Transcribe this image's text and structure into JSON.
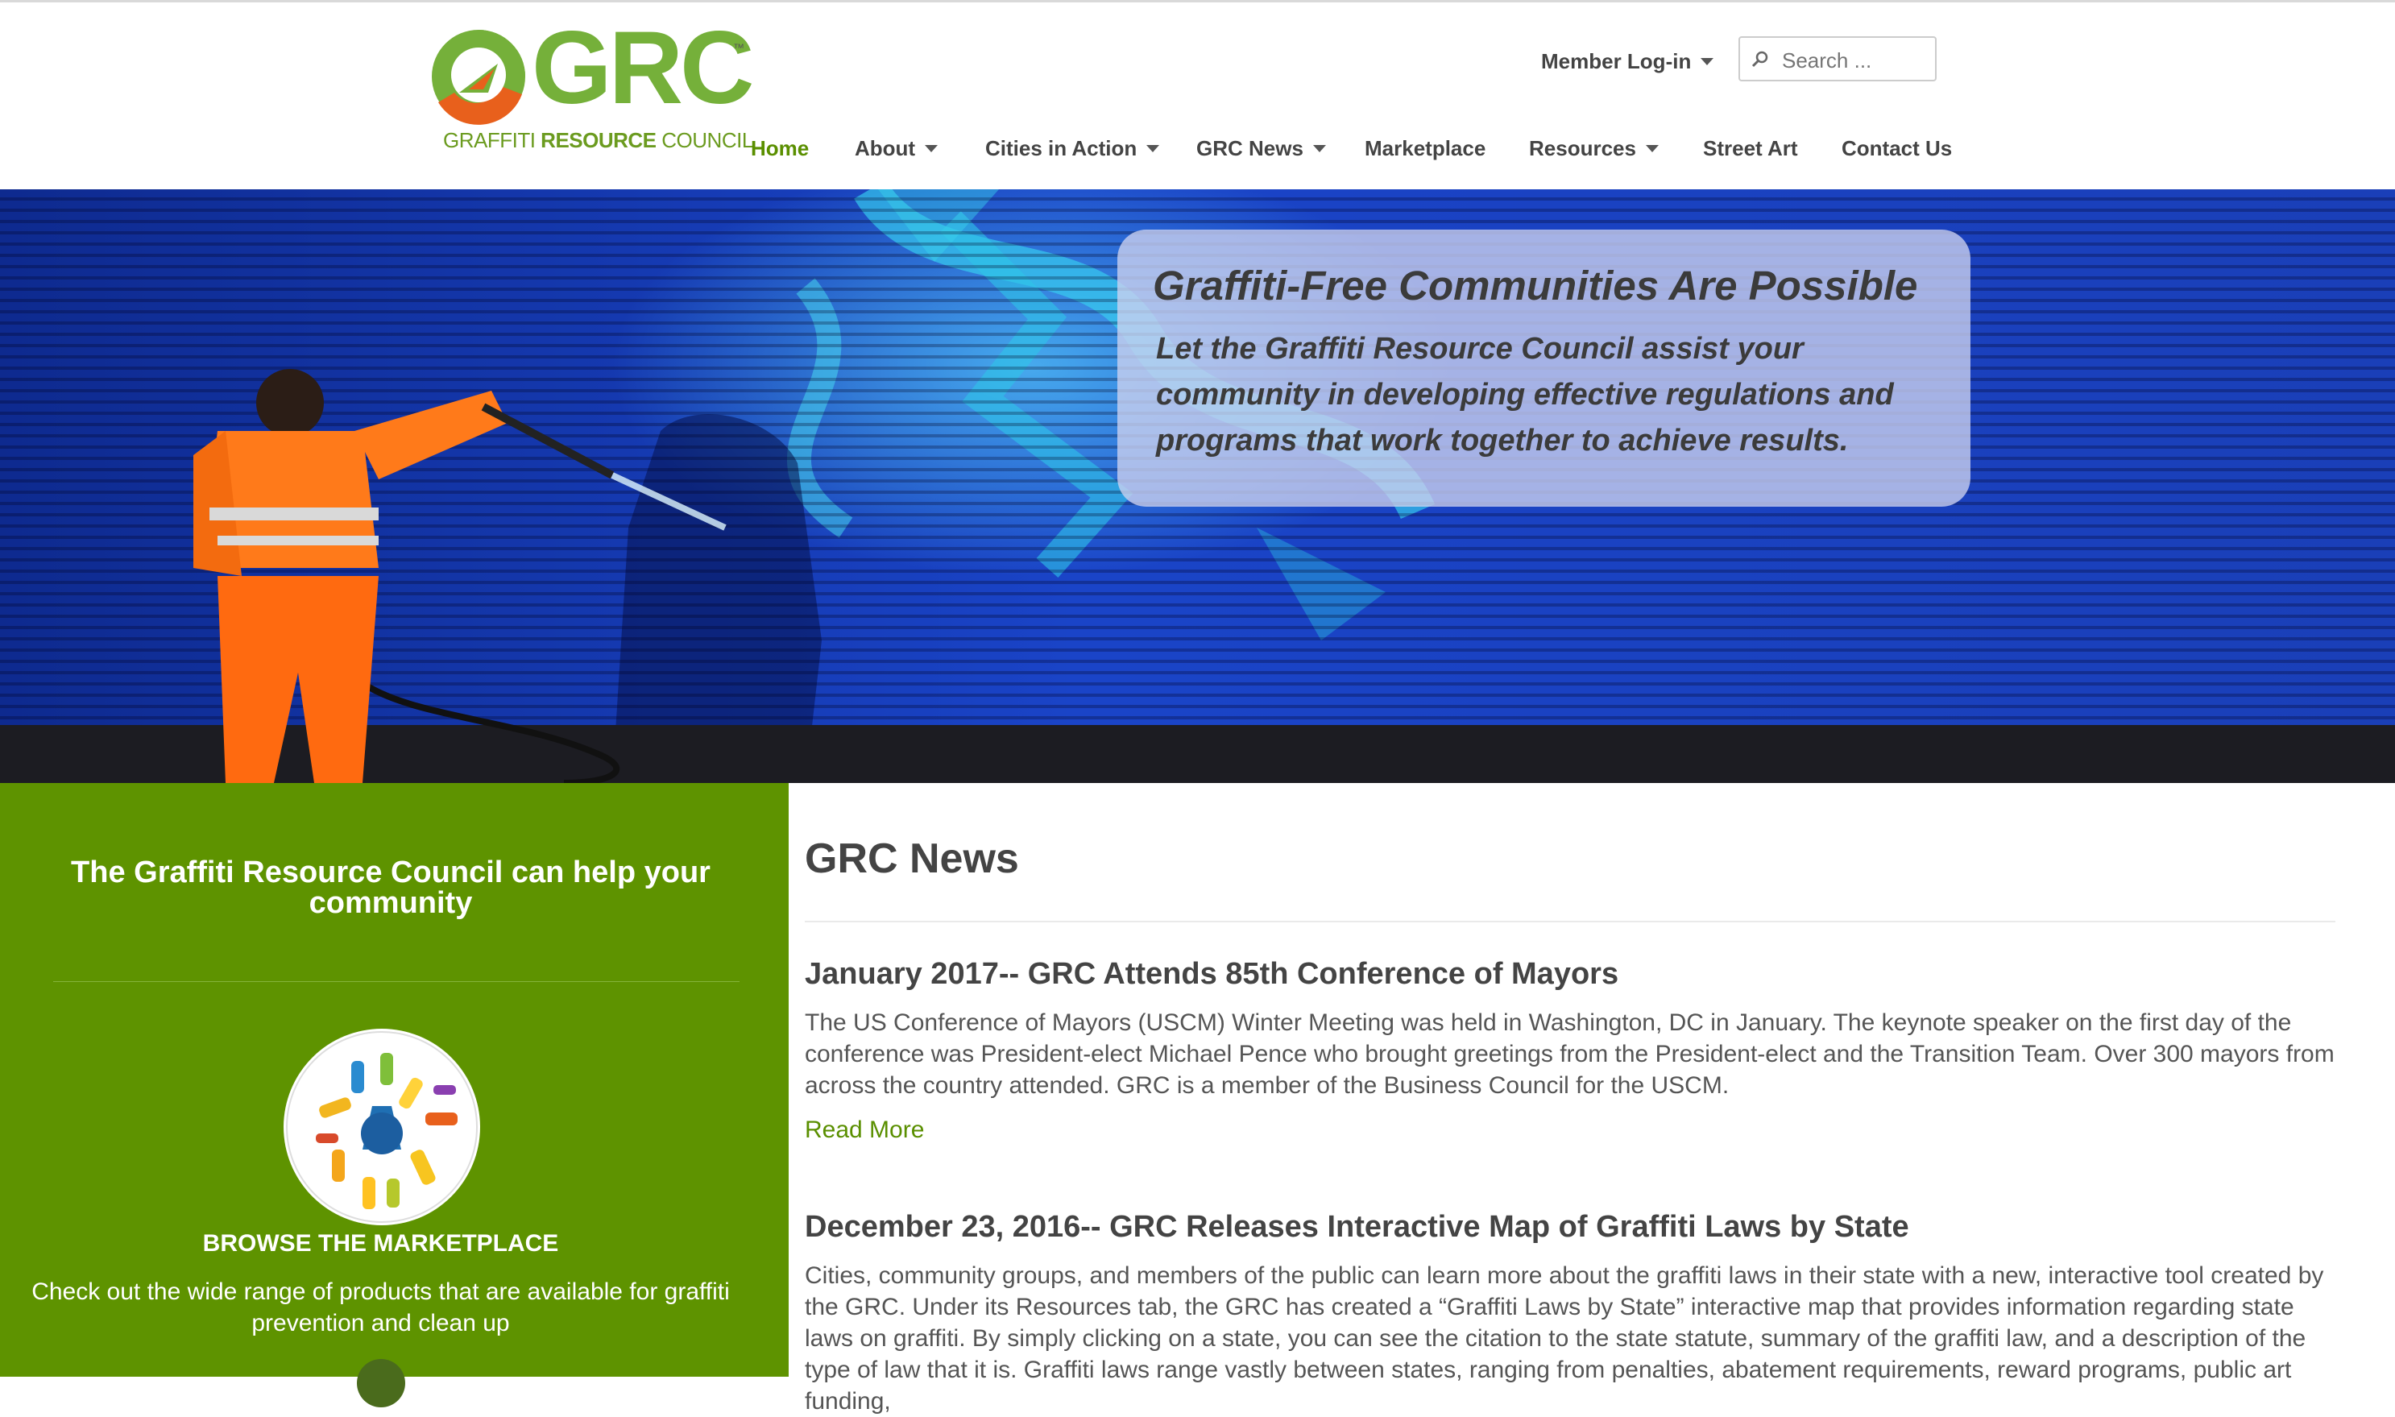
{
  "header": {
    "logo": {
      "letters": "GRC",
      "tagline_part1": "GRAFFITI",
      "tagline_part2": "RESOURCE",
      "tagline_part3": "COUNCIL",
      "tm": "™"
    },
    "member_login": "Member Log-in",
    "search_placeholder": "Search ...",
    "nav": [
      {
        "label": "Home",
        "active": true,
        "dropdown": false
      },
      {
        "label": "About",
        "active": false,
        "dropdown": true
      },
      {
        "label": "Cities in Action",
        "active": false,
        "dropdown": true
      },
      {
        "label": "GRC News",
        "active": false,
        "dropdown": true
      },
      {
        "label": "Marketplace",
        "active": false,
        "dropdown": false
      },
      {
        "label": "Resources",
        "active": false,
        "dropdown": true
      },
      {
        "label": "Street Art",
        "active": false,
        "dropdown": false
      },
      {
        "label": "Contact Us",
        "active": false,
        "dropdown": false
      }
    ]
  },
  "hero": {
    "title": "Graffiti-Free Communities Are Possible",
    "subtitle": "Let the Graffiti Resource Council assist your community in developing effective regulations and programs that work together to achieve results."
  },
  "promo": {
    "heading": "The Graffiti Resource Council can help your community",
    "marketplace_title": "BROWSE THE MARKETPLACE",
    "marketplace_desc": "Check out the wide range of products that are available for graffiti prevention and clean up"
  },
  "news": {
    "heading": "GRC News",
    "articles": [
      {
        "title": "January 2017-- GRC Attends 85th Conference of Mayors",
        "body": "The US Conference of Mayors (USCM) Winter Meeting was held in Washington, DC in January. The keynote speaker on the first day of the conference was President-elect Michael Pence who brought greetings from the President-elect and the Transition Team. Over 300 mayors from across the country attended. GRC is a member of the Business Council for the USCM.",
        "read_more": "Read More"
      },
      {
        "title": "December 23, 2016-- GRC Releases Interactive Map of Graffiti Laws by State",
        "body": "Cities, community groups, and members of the public can learn more about the graffiti laws in their state with a new, interactive tool created by the GRC. Under its Resources tab, the GRC has created a “Graffiti Laws by State” interactive map that provides information regarding state laws on graffiti. By simply clicking on a state, you can see the citation to the state statute, summary of the graffiti law, and a description of the type of law that it is. Graffiti laws range vastly between states, ranging from penalties, abatement requirements, reward programs, public art funding,"
      }
    ]
  },
  "colors": {
    "brand_green": "#75b03a",
    "brand_orange": "#e8601c",
    "panel_green": "#5e9300",
    "link_green": "#5a8f00",
    "hero_blue": "#1c3fbf"
  }
}
